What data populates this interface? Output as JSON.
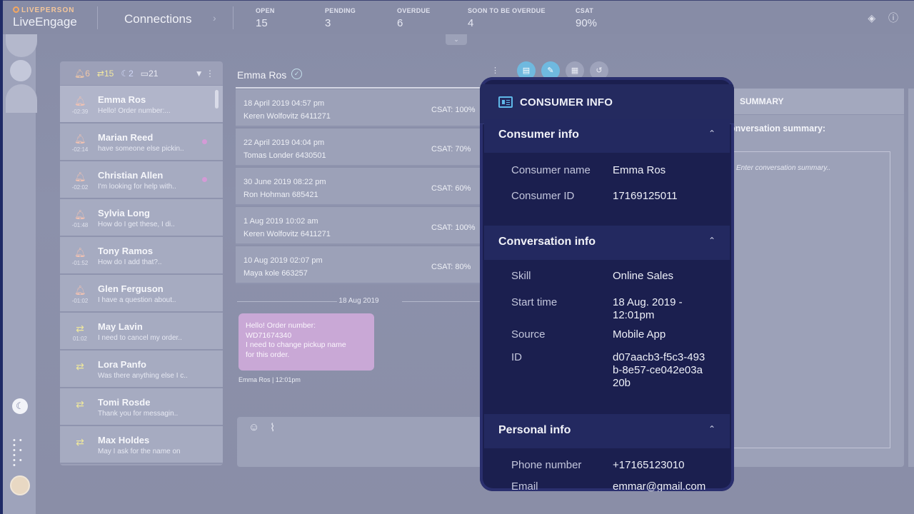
{
  "brand": {
    "top": "LIVEPERSON",
    "name": "LiveEngage"
  },
  "page_title": "Connections",
  "stats": [
    {
      "label": "OPEN",
      "value": "15"
    },
    {
      "label": "PENDING",
      "value": "3"
    },
    {
      "label": "OVERDUE",
      "value": "6"
    },
    {
      "label": "SOON TO BE OVERDUE",
      "value": "4"
    },
    {
      "label": "CSAT",
      "value": "90%"
    }
  ],
  "list_header": {
    "alerts": "6",
    "transfers": "15",
    "away": "2",
    "messages": "21"
  },
  "conversations": [
    {
      "name": "Emma Ros",
      "time": "-02:39",
      "message": "Hello! Order number:...",
      "icon": "bell-icon"
    },
    {
      "name": "Marian Reed",
      "time": "-02:14",
      "message": "have someone else pickin..",
      "icon": "bell-icon"
    },
    {
      "name": "Christian Allen",
      "time": "-02:02",
      "message": "I'm looking for help with..",
      "icon": "bell-icon"
    },
    {
      "name": "Sylvia Long",
      "time": "-01:48",
      "message": "How do I get these, I di..",
      "icon": "bell-icon"
    },
    {
      "name": "Tony Ramos",
      "time": "-01:52",
      "message": "How do I add that?..",
      "icon": "bell-icon"
    },
    {
      "name": "Glen Ferguson",
      "time": "-01:02",
      "message": "I have a question about..",
      "icon": "bell-icon"
    },
    {
      "name": "May Lavin",
      "time": "01:02",
      "message": "I need to cancel my order..",
      "icon": "transfer-icon"
    },
    {
      "name": "Lora Panfo",
      "time": "",
      "message": "Was there anything else I c..",
      "icon": "transfer-icon"
    },
    {
      "name": "Tomi Rosde",
      "time": "",
      "message": "Thank you for messagin..",
      "icon": "transfer-icon"
    },
    {
      "name": "Max Holdes",
      "time": "",
      "message": "May I ask for the name on",
      "icon": "transfer-icon"
    }
  ],
  "chat": {
    "name": "Emma Ros",
    "history": [
      {
        "date": "18 April 2019 04:57 pm",
        "agent": "Keren Wolfovitz  6411271",
        "csat": "CSAT: 100%"
      },
      {
        "date": "22 April 2019 04:04 pm",
        "agent": "Tomas Londer  6430501",
        "csat": "CSAT: 70%"
      },
      {
        "date": "30 June 2019 08:22 pm",
        "agent": "Ron Hohman  685421",
        "csat": "CSAT: 60%"
      },
      {
        "date": "1 Aug 2019 10:02 am",
        "agent": "Keren Wolfovitz  6411271",
        "csat": "CSAT: 100%"
      },
      {
        "date": "10 Aug 2019 02:07 pm",
        "agent": "Maya kole  663257",
        "csat": "CSAT: 80%"
      }
    ],
    "date_separator": "18 Aug 2019",
    "bubble_lines": [
      "Hello! Order number:",
      "WD71674340",
      "I need to change pickup name",
      "for this order."
    ],
    "bubble_meta": "Emma Ros  |  12:01pm"
  },
  "summary": {
    "header": "SUMMARY",
    "label": "onversation summary:",
    "placeholder": "Enter conversation summary.."
  },
  "consumer_info": {
    "title": "CONSUMER INFO",
    "section_consumer": "Consumer info",
    "consumer_name_label": "Consumer name",
    "consumer_name": "Emma Ros",
    "consumer_id_label": "Consumer ID",
    "consumer_id": "17169125011",
    "section_conversation": "Conversation info",
    "skill_label": "Skill",
    "skill": "Online Sales",
    "start_time_label": "Start time",
    "start_time": "18 Aug. 2019 - 12:01pm",
    "source_label": "Source",
    "source": "Mobile App",
    "id_label": "ID",
    "id": "d07aacb3-f5c3-493b-8e57-ce042e03a20b",
    "section_personal": "Personal info",
    "phone_label": "Phone number",
    "phone": "+17165123010",
    "email_label": "Email",
    "email": "emmar@gmail.com"
  },
  "colors": {
    "accent": "#5fb8e8",
    "modal_bg": "#1b1f4f",
    "bubble": "#c9a8d6"
  }
}
